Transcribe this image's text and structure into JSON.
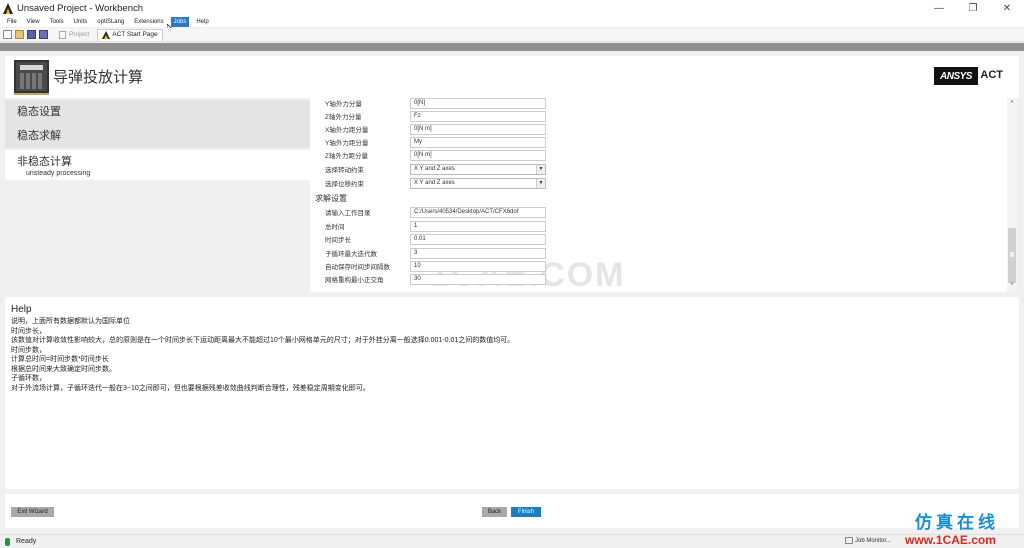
{
  "window": {
    "title": "Unsaved Project - Workbench",
    "controls": {
      "minimize": "—",
      "maximize": "❐",
      "close": "✕"
    }
  },
  "menubar": {
    "items": [
      "File",
      "View",
      "Tools",
      "Units",
      "optiSLang",
      "Extensions",
      "Jobs",
      "Help"
    ],
    "active": "Jobs"
  },
  "toolbar": {
    "icons": [
      "new-icon",
      "open-icon",
      "save-icon",
      "save-as-icon"
    ],
    "tabs": [
      {
        "label": "Project",
        "active": false
      },
      {
        "label": "ACT Start Page",
        "active": true
      }
    ]
  },
  "header": {
    "title": "导弹投放计算",
    "brand": "ANSYS",
    "brand_suffix": "ACT"
  },
  "sidebar": {
    "steps": [
      {
        "label": "稳态设置"
      },
      {
        "label": "稳态求解"
      },
      {
        "label": "非稳态计算",
        "sublabel": "unsteady processing",
        "active": true
      }
    ]
  },
  "form": {
    "rows_top": [
      {
        "label": "Y轴外力分量",
        "value": "0[N]",
        "type": "input"
      },
      {
        "label": "Z轴外力分量",
        "value": "Fz",
        "type": "input"
      },
      {
        "label": "X轴外力距分量",
        "value": "0[N m]",
        "type": "input"
      },
      {
        "label": "Y轴外力距分量",
        "value": "My",
        "type": "input"
      },
      {
        "label": "Z轴外力距分量",
        "value": "0[N m]",
        "type": "input"
      },
      {
        "label": "选择转动约束",
        "value": "X Y and Z axes",
        "type": "select"
      },
      {
        "label": "选择位移约束",
        "value": "X Y and Z axes",
        "type": "select"
      }
    ],
    "solve_section_title": "求解设置",
    "rows_solve": [
      {
        "label": "请输入工作目录",
        "value": "C:/Users/40534/Desktop/ACT/CFX6dof"
      },
      {
        "label": "总时间",
        "value": "1"
      },
      {
        "label": "时间步长",
        "value": "0.01"
      },
      {
        "label": "子循环最大迭代数",
        "value": "3"
      },
      {
        "label": "自动保存时间步间隔数",
        "value": "10"
      },
      {
        "label": "网格重构最小正交角",
        "value": "30"
      }
    ],
    "watermark": "1CAE.COM"
  },
  "help": {
    "title": "Help",
    "lines": [
      "说明，上面所有数据都默认为国际单位",
      "时间步长，",
      "该数值对计算收敛性影响较大，总的原则是在一个时间步长下运动距离最大不能超过10个最小网格单元的尺寸；对于外挂分离一般选择0.001-0.01之间的数值均可。",
      "时间步数，",
      "计算总时间=时间步数*时间步长",
      "根据总时间来大致确定时间步数。",
      "子循环数，",
      "对于外流场计算，子循环迭代一般在3~10之间即可，但也要根据残差收敛曲线判断合理性，残差稳定周期变化即可。"
    ]
  },
  "buttons": {
    "exit_wizard": "Exit Wizard",
    "back": "Back",
    "finish": "Finish"
  },
  "statusbar": {
    "status": "Ready",
    "job_monitor": "Job Monitor..."
  },
  "branding": {
    "cn": "仿真在线",
    "url": "www.1CAE.com"
  }
}
